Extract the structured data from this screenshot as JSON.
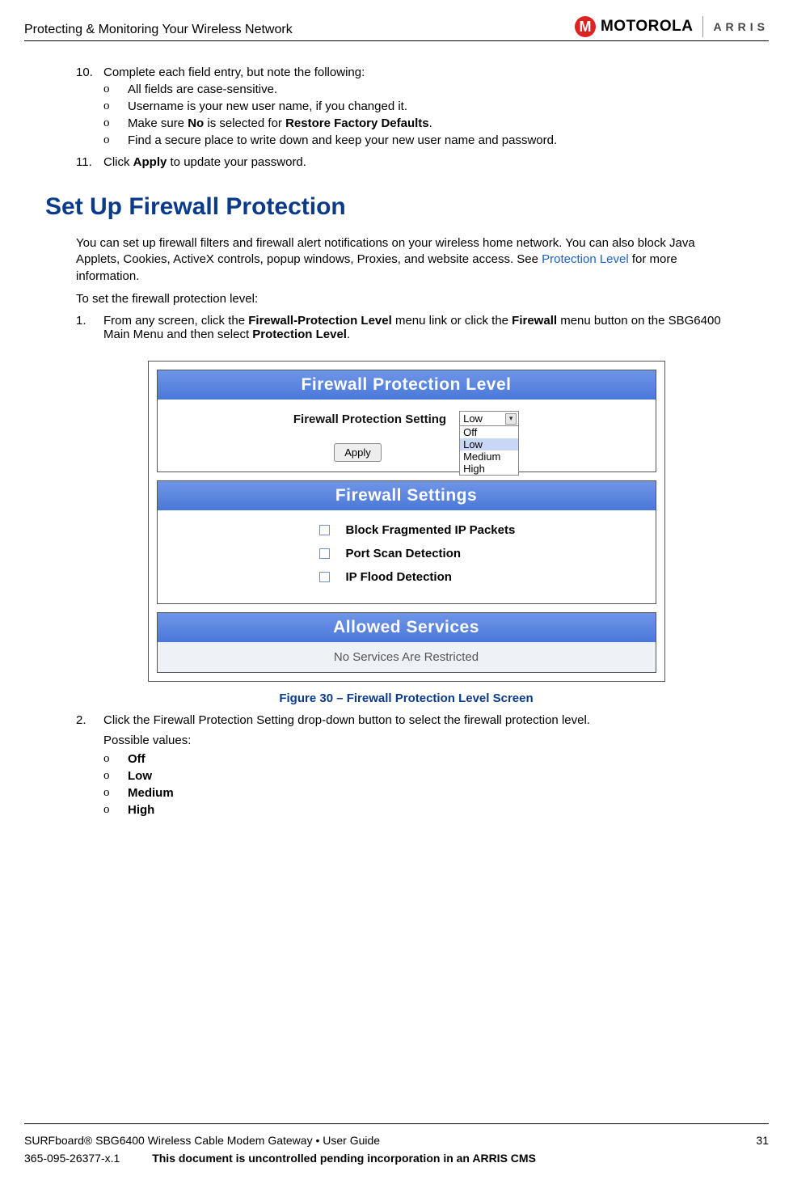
{
  "header": {
    "title": "Protecting & Monitoring Your Wireless Network",
    "moto_text": "MOTOROLA",
    "arris_text": "ARRIS"
  },
  "steps_top": {
    "s10_num": "10.",
    "s10_text": "Complete each field entry, but note the following:",
    "s10_sub": [
      "All fields are case-sensitive.",
      "Username is your new user name, if you changed it."
    ],
    "s10_sub3_pre": "Make sure ",
    "s10_sub3_bold1": "No",
    "s10_sub3_mid": " is selected for ",
    "s10_sub3_bold2": "Restore Factory Defaults",
    "s10_sub3_post": ".",
    "s10_sub4": "Find a secure place to write down and keep your new user name and password.",
    "s11_num": "11.",
    "s11_pre": "Click ",
    "s11_bold": "Apply",
    "s11_post": " to update your password."
  },
  "heading": "Set Up Firewall Protection",
  "intro": {
    "p1_pre": "You can set up firewall filters and firewall alert notifications on your wireless home network. You can also block Java Applets, Cookies, ActiveX controls, popup windows, Proxies, and website access. See ",
    "p1_link": "Protection Level",
    "p1_post": " for more information.",
    "p2": "To set the firewall protection level:"
  },
  "steps_mid": {
    "s1_num": "1.",
    "s1_pre": "From any screen, click the ",
    "s1_bold1": "Firewall-Protection Level",
    "s1_mid": " menu link or click the ",
    "s1_bold2": "Firewall",
    "s1_post1": " menu button on the SBG6400 Main Menu and then select ",
    "s1_bold3": "Protection Level",
    "s1_post2": "."
  },
  "figure": {
    "panel1_title": "Firewall Protection Level",
    "control_label": "Firewall Protection Setting",
    "select_current": "Low",
    "select_options": [
      "Off",
      "Low",
      "Medium",
      "High"
    ],
    "apply_btn": "Apply",
    "panel2_title": "Firewall Settings",
    "settings": [
      "Block Fragmented IP Packets",
      "Port Scan Detection",
      "IP Flood Detection"
    ],
    "panel3_title": "Allowed Services",
    "allowed_text": "No Services Are Restricted",
    "caption": "Figure 30 – Firewall Protection Level Screen"
  },
  "steps_bottom": {
    "s2_num": "2.",
    "s2_text": "Click the Firewall Protection Setting drop-down button to select the firewall protection level.",
    "s2_lead": "Possible values:",
    "s2_values": [
      "Off",
      "Low",
      "Medium",
      "High"
    ]
  },
  "footer": {
    "product": "SURFboard® SBG6400 Wireless Cable Modem Gateway • User Guide",
    "page": "31",
    "docnum": "365-095-26377-x.1",
    "notice": "This document is uncontrolled pending incorporation in an ARRIS CMS"
  }
}
